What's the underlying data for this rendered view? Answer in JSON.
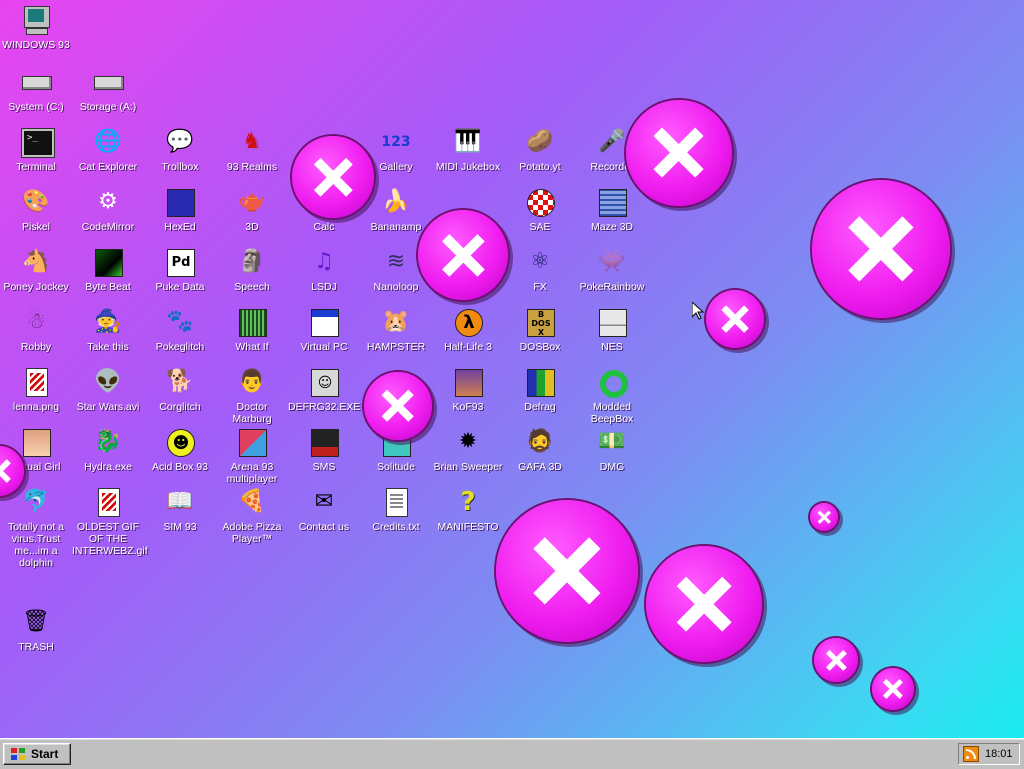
{
  "desktop": {
    "icons": {
      "windows93": "WINDOWS 93",
      "system_c": "System (C:)",
      "storage_a": "Storage (A:)",
      "terminal": "Terminal",
      "cat_explorer": "Cat Explorer",
      "trollbox": "Trollbox",
      "93_realms": "93 Realms",
      "gallery": "Gallery",
      "midi_jukebox": "MIDI Jukebox",
      "potato": "Potato.yt",
      "recorder": "Recorder",
      "piskel": "Piskel",
      "codemirror": "CodeMirror",
      "hexed": "HexEd",
      "3d": "3D",
      "calc": "Calc",
      "bananamp": "Bananamp",
      "sae": "SAE",
      "maze3d": "Maze 3D",
      "poney_jockey": "Poney Jockey",
      "byte_beat": "Byte Beat",
      "puke_data": "Puke Data",
      "speech": "Speech",
      "lsdj": "LSDJ",
      "nanoloop": "Nanoloop",
      "fx": "FX",
      "pokerainbow": "PokeRainbow",
      "robby": "Robby",
      "take_this": "Take this",
      "pokeglitch": "Pokeglitch",
      "what_if": "What If",
      "virtual_pc": "Virtual PC",
      "hampster": "HAMPSTER",
      "half_life_3": "Half-Life 3",
      "dosbox": "DOSBox",
      "nes": "NES",
      "lenna": "lenna.png",
      "star_wars": "Star Wars.avi",
      "corglitch": "Corglitch",
      "doctor_marburg": "Doctor Marburg",
      "defrag32": "DEFRG32.EXE",
      "kof93": "KoF93",
      "defrag": "Defrag",
      "modded_beepbox": "Modded BeepBox",
      "virtual_girl": "Virtual Girl",
      "hydra": "Hydra.exe",
      "acid_box": "Acid Box 93",
      "arena93": "Arena 93 multiplayer",
      "sms": "SMS",
      "solitude": "Solitude",
      "brian_sweeper": "Brian Sweeper",
      "gafa3d": "GAFA 3D",
      "dmg": "DMG",
      "dolphin": "Totally not a virus.Trust me...im a dolphin",
      "oldest_gif": "OLDEST GIF OF THE INTERWEBZ.gif",
      "sim93": "SIM 93",
      "adobe_pizza": "Adobe Pizza Player™",
      "contact_us": "Contact us",
      "credits": "Credits.txt",
      "manifesto": "MANIFESTO",
      "trash": "TRASH"
    }
  },
  "taskbar": {
    "start_label": "Start",
    "clock": "18:01"
  },
  "colors": {
    "accent_pink": "#f01ef0",
    "taskbar_gray": "#c0c0c0",
    "label_text": "#ffffff"
  }
}
